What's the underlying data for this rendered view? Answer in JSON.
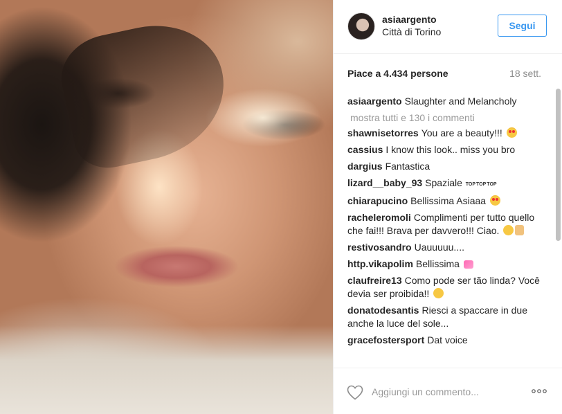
{
  "post": {
    "username": "asiaargento",
    "location": "Città di Torino",
    "follow_label": "Segui",
    "likes": "Piace a 4.434 persone",
    "age": "18 sett."
  },
  "caption": {
    "author": "asiaargento",
    "text": "Slaughter and Melancholy"
  },
  "view_all": "mostra tutti e 130 i commenti",
  "comments": [
    {
      "author": "shawnisetorres",
      "text": "You are a beauty!!!"
    },
    {
      "author": "cassius",
      "text": "I know this look.. miss you bro"
    },
    {
      "author": "dargius",
      "text": "Fantastica"
    },
    {
      "author": "lizard__baby_93",
      "text": "Spaziale"
    },
    {
      "author": "chiarapucino",
      "text": "Bellissima Asiaaa"
    },
    {
      "author": "racheleromoli",
      "text": "Complimenti per tutto quello che fai!!! Brava per davvero!!! Ciao."
    },
    {
      "author": "restivosandro",
      "text": "Uauuuuu...."
    },
    {
      "author": "http.vikapolim",
      "text": "Bellissima"
    },
    {
      "author": "claufreire13",
      "text": "Como pode ser tão linda? Você devia ser proibida!!"
    },
    {
      "author": "donatodesantis",
      "text": "Riesci a spaccare in due anche la luce del sole..."
    },
    {
      "author": "gracefostersport",
      "text": "Dat voice"
    }
  ],
  "top_badge": "TOP",
  "footer": {
    "add_comment_placeholder": "Aggiungi un commento..."
  },
  "icons": {
    "like": "heart-icon",
    "options": "more-icon"
  }
}
